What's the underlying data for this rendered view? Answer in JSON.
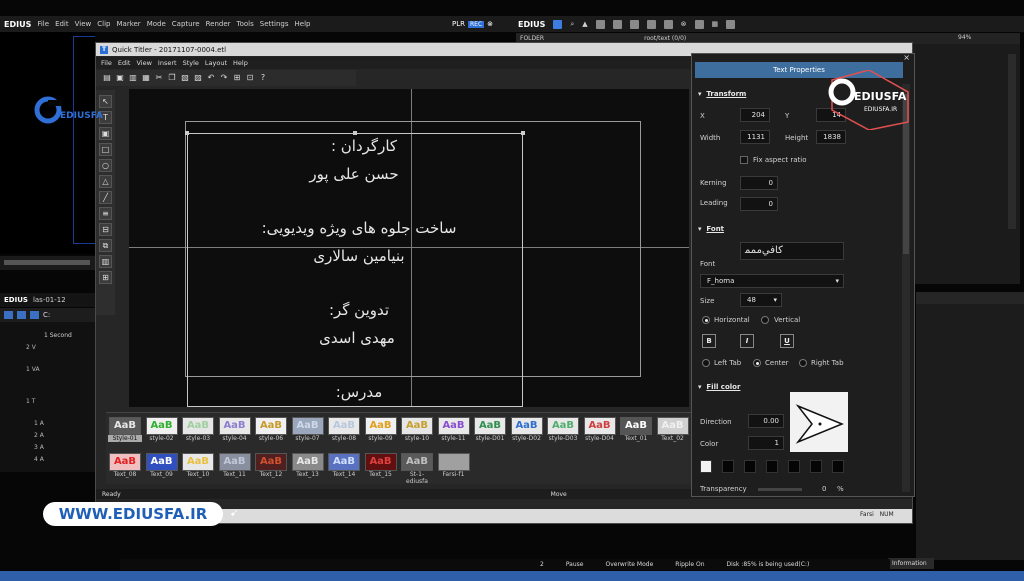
{
  "edius": {
    "brand": "EDIUS",
    "menu": [
      "File",
      "Edit",
      "View",
      "Clip",
      "Marker",
      "Mode",
      "Capture",
      "Render",
      "Tools",
      "Settings",
      "Help"
    ],
    "plr": "PLR",
    "rec": "REC",
    "right_brand": "EDIUS",
    "folder_label": "FOLDER",
    "folder_path": "root/text (0/0)",
    "zoom": "94%",
    "timeline_brand": "EDIUS",
    "timeline_sequence": "las-01-12",
    "timeline_zoom": "1 Second",
    "tracks": [
      "2 V",
      "1 VA",
      "1 T",
      "1 A",
      "2 A",
      "3 A",
      "4 A"
    ],
    "info_tab": "Information",
    "status": {
      "count": "2",
      "state": "Pause",
      "mode": "Overwrite Mode",
      "ripple": "Ripple On",
      "disk": "Disk :85% is being used(C:)"
    }
  },
  "quick_titler": {
    "title": "Quick Titler - 20171107-0004.etl",
    "menu": [
      "File",
      "Edit",
      "View",
      "Insert",
      "Style",
      "Layout",
      "Help"
    ],
    "status_left": "Ready",
    "status_mid": "Move",
    "lang": "Farsi",
    "num": "NUM",
    "canvas_lines": [
      "کارگردان :",
      "حسن علی پور",
      "ساخت جلوه های ویژه ویدیویی:",
      "بنیامین سالاری",
      "تدوین گر:",
      "مهدی اسدی",
      "مدرس:"
    ],
    "styles": [
      {
        "label": "Style-01",
        "sample": "AaB",
        "color": "#e8e8e8",
        "bg": "#5a5a5a"
      },
      {
        "label": "style-02",
        "sample": "AaB",
        "color": "#2fb02f",
        "bg": "#f0f0f0"
      },
      {
        "label": "style-03",
        "sample": "AaB",
        "color": "#9fcf9f",
        "bg": "#e6e6e6"
      },
      {
        "label": "style-04",
        "sample": "AaB",
        "color": "#8a7fd0",
        "bg": "#e8e8e8"
      },
      {
        "label": "style-06",
        "sample": "AaB",
        "color": "#c79a2a",
        "bg": "#f0f0f0"
      },
      {
        "label": "style-07",
        "sample": "AaB",
        "color": "#cfd8e8",
        "bg": "#9aa7bd"
      },
      {
        "label": "style-08",
        "sample": "AaB",
        "color": "#b8c7e0",
        "bg": "#e8e8e8"
      },
      {
        "label": "style-09",
        "sample": "AaB",
        "color": "#e0a020",
        "bg": "#f0f0f0"
      },
      {
        "label": "style-10",
        "sample": "AaB",
        "color": "#c8a030",
        "bg": "#e6e6e6"
      },
      {
        "label": "style-11",
        "sample": "AaB",
        "color": "#8a4fd0",
        "bg": "#e8e8e8"
      },
      {
        "label": "style-D01",
        "sample": "AaB",
        "color": "#2f8f4f",
        "bg": "#e8e8e8"
      },
      {
        "label": "style-D02",
        "sample": "AaB",
        "color": "#2f6fcf",
        "bg": "#e8e8e8"
      },
      {
        "label": "style-D03",
        "sample": "AaB",
        "color": "#4faf6f",
        "bg": "#e8e8e8"
      },
      {
        "label": "style-D04",
        "sample": "AaB",
        "color": "#cf3f3f",
        "bg": "#e8e8e8"
      },
      {
        "label": "Text_01",
        "sample": "AaB",
        "color": "#ffffff",
        "bg": "#555555"
      },
      {
        "label": "Text_02",
        "sample": "AaB",
        "color": "#f0f0f0",
        "bg": "#d0d0d0"
      },
      {
        "label": "Text_08",
        "sample": "AaB",
        "color": "#e02020",
        "bg": "#f0c0c0"
      },
      {
        "label": "Text_09",
        "sample": "AaB",
        "color": "#ffffff",
        "bg": "#3050c0"
      },
      {
        "label": "Text_10",
        "sample": "AaB",
        "color": "#e8c040",
        "bg": "#e8e8e8"
      },
      {
        "label": "Text_11",
        "sample": "AaB",
        "color": "#c0c8d8",
        "bg": "#8a8fa0"
      },
      {
        "label": "Text_12",
        "sample": "AaB",
        "color": "#d05030",
        "bg": "#502020"
      },
      {
        "label": "Text_13",
        "sample": "AaB",
        "color": "#e8e8e8",
        "bg": "#8a8a8a"
      },
      {
        "label": "Text_14",
        "sample": "AaB",
        "color": "#d0e0ff",
        "bg": "#5a70c0"
      },
      {
        "label": "Text_15",
        "sample": "AaB",
        "color": "#e04040",
        "bg": "#601010"
      },
      {
        "label": "St-1-ediusfa",
        "sample": "AaB",
        "color": "#c0c0c0",
        "bg": "#5a5a5a"
      },
      {
        "label": "Farsi-f1",
        "sample": "",
        "color": "#e07090",
        "bg": "#a0a0a0"
      }
    ]
  },
  "props": {
    "title": "Text Properties",
    "transform": "Transform",
    "x_label": "X",
    "x_value": "204",
    "y_label": "Y",
    "y_value": "14",
    "width_label": "Width",
    "width_value": "1131",
    "height_label": "Height",
    "height_value": "1838",
    "fix_aspect": "Fix aspect ratio",
    "kerning_label": "Kerning",
    "kerning_value": "0",
    "leading_label": "Leading",
    "leading_value": "0",
    "font_section": "Font",
    "font_preview": "ﮐﺎﻓﻲﻣﻤﻤ",
    "font_label": "Font",
    "font_value": "F_homa",
    "size_label": "Size",
    "size_value": "48",
    "horizontal": "Horizontal",
    "vertical": "Vertical",
    "bold": "B",
    "italic": "I",
    "underline": "U",
    "left_tab": "Left Tab",
    "center": "Center",
    "right_tab": "Right Tab",
    "fill_section": "Fill color",
    "direction_label": "Direction",
    "direction_value": "0.00",
    "color_label": "Color",
    "color_value": "1",
    "transparency_label": "Transparency",
    "transparency_value": "0",
    "percent": "%"
  },
  "watermark": {
    "brand": "EDIUSFA",
    "site": "EDIUSFA.IR",
    "banner": "WWW.EDIUSFA.IR",
    "left_brand": "EDIUSFA"
  }
}
